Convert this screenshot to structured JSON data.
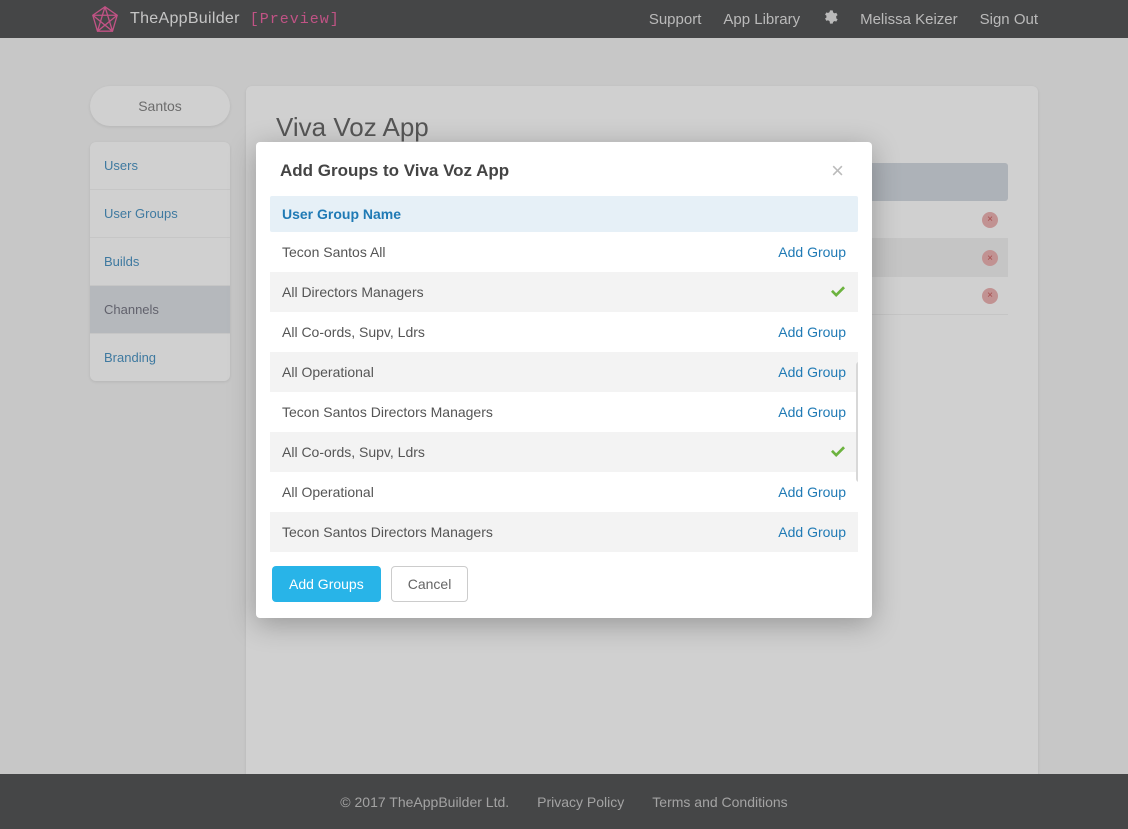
{
  "brand": {
    "name": "TheAppBuilder",
    "tag": "[Preview]"
  },
  "topnav": {
    "support": "Support",
    "appLibrary": "App Library",
    "user": "Melissa Keizer",
    "signOut": "Sign Out"
  },
  "sidebar": {
    "org": "Santos",
    "items": [
      {
        "label": "Users",
        "key": "users"
      },
      {
        "label": "User Groups",
        "key": "user-groups"
      },
      {
        "label": "Builds",
        "key": "builds"
      },
      {
        "label": "Channels",
        "key": "channels",
        "active": true
      },
      {
        "label": "Branding",
        "key": "branding"
      }
    ]
  },
  "main": {
    "title": "Viva Voz App",
    "rows": [
      "",
      "",
      "",
      ""
    ]
  },
  "modal": {
    "title": "Add Groups to Viva Voz App",
    "columnHeader": "User Group Name",
    "addLabel": "Add Group",
    "groups": [
      {
        "name": "Tecon Santos All",
        "added": false
      },
      {
        "name": "All Directors Managers",
        "added": true
      },
      {
        "name": "All Co-ords, Supv, Ldrs",
        "added": false
      },
      {
        "name": "All Operational",
        "added": false
      },
      {
        "name": "Tecon Santos Directors Managers",
        "added": false
      },
      {
        "name": "All Co-ords, Supv, Ldrs",
        "added": true
      },
      {
        "name": "All Operational",
        "added": false
      },
      {
        "name": "Tecon Santos Directors Managers",
        "added": false
      }
    ],
    "primary": "Add Groups",
    "secondary": "Cancel"
  },
  "footer": {
    "copyright": "© 2017 TheAppBuilder Ltd.",
    "privacy": "Privacy Policy",
    "terms": "Terms and Conditions"
  }
}
